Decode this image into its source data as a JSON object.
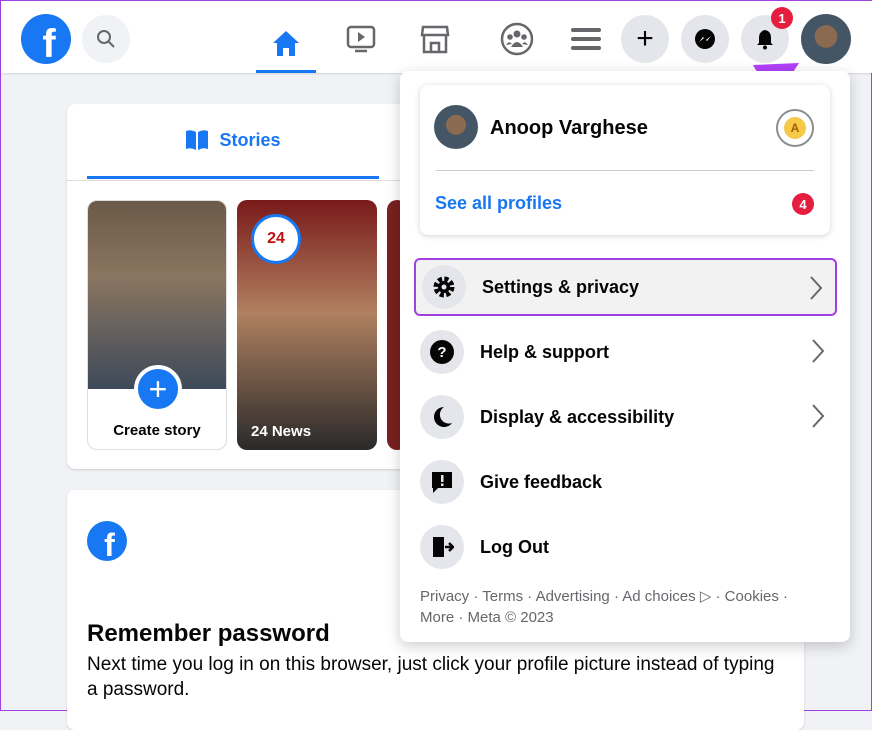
{
  "header": {
    "notification_count": "1",
    "nav": [
      "home",
      "watch",
      "marketplace",
      "groups",
      "menu"
    ]
  },
  "stories": {
    "tab_label": "Stories",
    "create_story": "Create story",
    "story_name": "24 News"
  },
  "remember": {
    "title": "Remember password",
    "text": "Next time you log in on this browser, just click your profile picture instead of typing a password."
  },
  "menu": {
    "profile_name": "Anoop Varghese",
    "see_all_profiles": "See all profiles",
    "profiles_badge": "4",
    "items": [
      {
        "label": "Settings & privacy",
        "icon": "gear-icon"
      },
      {
        "label": "Help & support",
        "icon": "question-icon"
      },
      {
        "label": "Display & accessibility",
        "icon": "moon-icon"
      },
      {
        "label": "Give feedback",
        "icon": "feedback-icon"
      },
      {
        "label": "Log Out",
        "icon": "logout-icon"
      }
    ],
    "footer_line1": "Privacy · Terms · Advertising · Ad choices ▷ · Cookies ·",
    "footer_line2": "More · Meta © 2023"
  },
  "colors": {
    "brand": "#1877f2",
    "highlight": "#a040e0",
    "badge": "#e41e3f"
  }
}
